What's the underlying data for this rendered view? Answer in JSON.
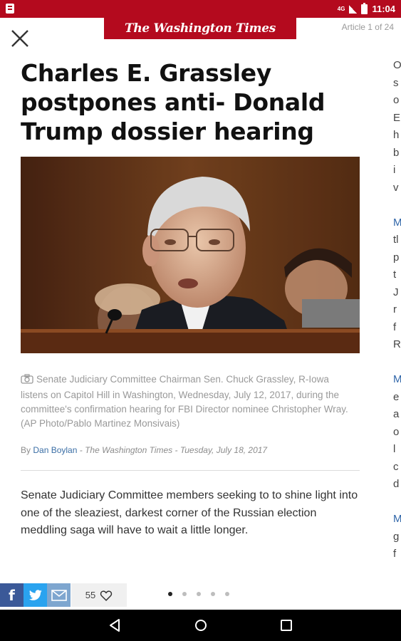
{
  "status_bar": {
    "network": "4G",
    "time": "11:04"
  },
  "header": {
    "masthead": "The Washington Times",
    "counter": "Article 1 of 24"
  },
  "article": {
    "headline": "Charles E. Grassley postpones anti- Donald Trump dossier hearing",
    "caption": "Senate Judiciary Committee Chairman Sen. Chuck Grassley, R-Iowa listens on Capitol Hill in Washington, Wednesday, July 12, 2017, during the committee's confirmation hearing for FBI Director nominee Christopher Wray. (AP Photo/Pablo Martinez Monsivais)",
    "byline": {
      "prefix": "By",
      "author": "Dan Boylan",
      "publication": "- The Washington Times -",
      "date": "Tuesday, July 18, 2017"
    },
    "body": "Senate Judiciary Committee members seeking to to shine light into one of the sleaziest, darkest corner of the Russian election meddling saga will have to wait a little longer."
  },
  "next_article_peek": [
    "O",
    "s",
    "o",
    "E",
    "h",
    "b",
    "i",
    "v",
    "",
    "M",
    "tl",
    "p",
    "t",
    "J",
    "r",
    "f",
    "R",
    "",
    "M",
    "e",
    "a",
    "o",
    "l",
    "c",
    "d",
    "",
    "M",
    "g",
    "f"
  ],
  "footer": {
    "likes_count": "55",
    "share_facebook": "f",
    "pages": 5,
    "active_page": 0
  },
  "colors": {
    "brand_red": "#b40a1e",
    "facebook": "#3b5998",
    "twitter": "#2aa3ef",
    "email": "#7ea6cf",
    "link": "#3a6ea5"
  },
  "icons": [
    "close-icon",
    "camera-icon",
    "facebook-icon",
    "twitter-icon",
    "email-icon",
    "heart-icon",
    "back-icon",
    "home-icon",
    "recents-icon"
  ]
}
